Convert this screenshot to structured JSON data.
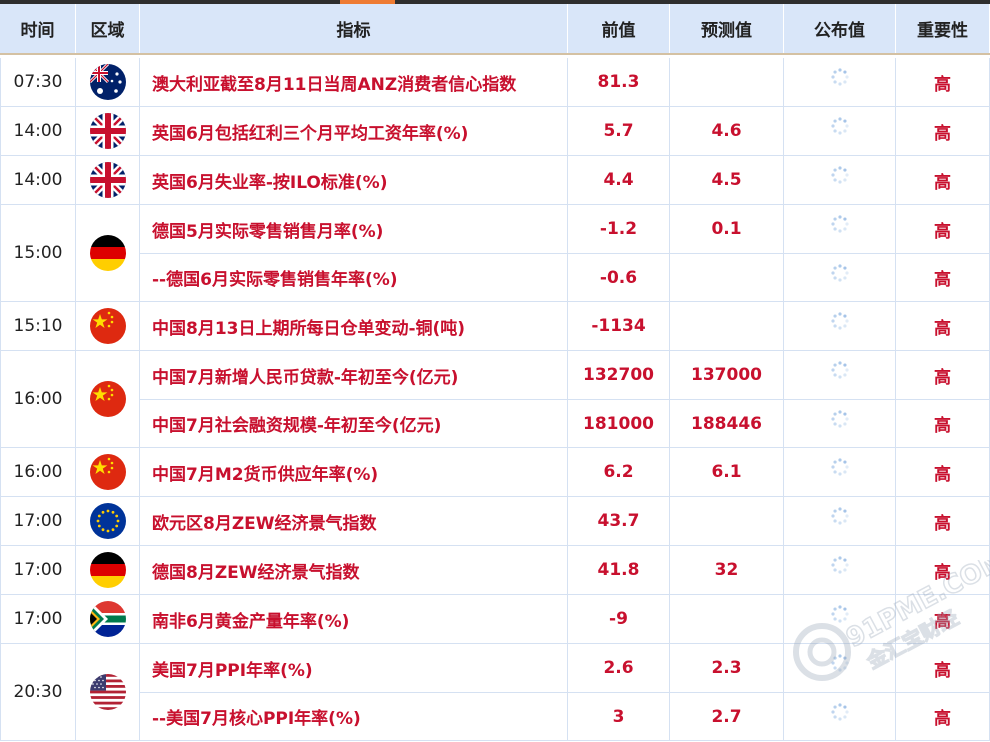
{
  "header": {
    "time": "时间",
    "area": "区域",
    "indicator": "指标",
    "previous": "前值",
    "forecast": "预测值",
    "published": "公布值",
    "importance": "重要性"
  },
  "colors": {
    "accent_red": "#c8102e",
    "header_bg": "#d9e6f9",
    "top_accent": "#ee7b33"
  },
  "groups": [
    {
      "time": "07:30",
      "flag": "australia-flag",
      "rows": [
        {
          "indicator": "澳大利亚截至8月11日当周ANZ消费者信心指数",
          "previous": "81.3",
          "forecast": "",
          "importance": "高"
        }
      ]
    },
    {
      "time": "14:00",
      "flag": "uk-flag",
      "rows": [
        {
          "indicator": "英国6月包括红利三个月平均工资年率(%)",
          "previous": "5.7",
          "forecast": "4.6",
          "importance": "高"
        }
      ]
    },
    {
      "time": "14:00",
      "flag": "uk-flag",
      "rows": [
        {
          "indicator": "英国6月失业率-按ILO标准(%)",
          "previous": "4.4",
          "forecast": "4.5",
          "importance": "高"
        }
      ]
    },
    {
      "time": "15:00",
      "flag": "germany-flag",
      "rows": [
        {
          "indicator": "德国5月实际零售销售月率(%)",
          "previous": "-1.2",
          "forecast": "0.1",
          "importance": "高"
        },
        {
          "indicator": "--德国6月实际零售销售年率(%)",
          "previous": "-0.6",
          "forecast": "",
          "importance": "高"
        }
      ]
    },
    {
      "time": "15:10",
      "flag": "china-flag",
      "rows": [
        {
          "indicator": "中国8月13日上期所每日仓单变动-铜(吨)",
          "previous": "-1134",
          "forecast": "",
          "importance": "高"
        }
      ]
    },
    {
      "time": "16:00",
      "flag": "china-flag",
      "rows": [
        {
          "indicator": "中国7月新增人民币贷款-年初至今(亿元)",
          "previous": "132700",
          "forecast": "137000",
          "importance": "高"
        },
        {
          "indicator": "中国7月社会融资规模-年初至今(亿元)",
          "previous": "181000",
          "forecast": "188446",
          "importance": "高"
        }
      ]
    },
    {
      "time": "16:00",
      "flag": "china-flag",
      "rows": [
        {
          "indicator": "中国7月M2货币供应年率(%)",
          "previous": "6.2",
          "forecast": "6.1",
          "importance": "高"
        }
      ]
    },
    {
      "time": "17:00",
      "flag": "eu-flag",
      "rows": [
        {
          "indicator": "欧元区8月ZEW经济景气指数",
          "previous": "43.7",
          "forecast": "",
          "importance": "高"
        }
      ]
    },
    {
      "time": "17:00",
      "flag": "germany-flag",
      "rows": [
        {
          "indicator": "德国8月ZEW经济景气指数",
          "previous": "41.8",
          "forecast": "32",
          "importance": "高"
        }
      ]
    },
    {
      "time": "17:00",
      "flag": "south-africa-flag",
      "rows": [
        {
          "indicator": "南非6月黄金产量年率(%)",
          "previous": "-9",
          "forecast": "",
          "importance": "高"
        }
      ]
    },
    {
      "time": "20:30",
      "flag": "usa-flag",
      "rows": [
        {
          "indicator": "美国7月PPI年率(%)",
          "previous": "2.6",
          "forecast": "2.3",
          "importance": "高"
        },
        {
          "indicator": "--美国7月核心PPI年率(%)",
          "previous": "3",
          "forecast": "2.7",
          "importance": "高"
        }
      ]
    }
  ],
  "watermark": {
    "line1": "91PME.COM",
    "line2": "金汇宝财经"
  }
}
